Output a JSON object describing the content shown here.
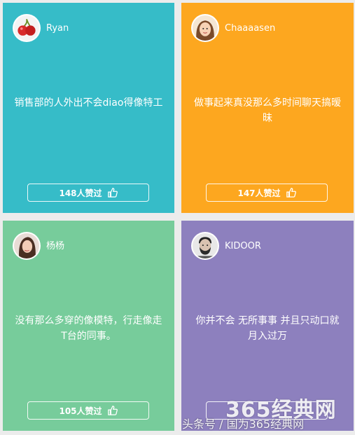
{
  "colors": {
    "teal": "#36bcc8",
    "orange": "#fda71f",
    "green": "#77cc9b",
    "purple": "#8d80be",
    "background": "#ececec"
  },
  "cards": [
    {
      "username": "Ryan",
      "avatar_icon": "cherry-avatar-icon",
      "text": "销售部的人外出不会diao得像特工",
      "likes": "148人赞过"
    },
    {
      "username": "Chaaaasen",
      "avatar_icon": "cartoon-girl-avatar-icon",
      "text": "做事起来真没那么多时间聊天搞暧昧",
      "likes": "147人赞过"
    },
    {
      "username": "杨杨",
      "avatar_icon": "woman-photo-avatar-icon",
      "text": "没有那么多穿的像模特，行走像走T台的同事。",
      "likes": "105人赞过"
    },
    {
      "username": "KIDOOR",
      "avatar_icon": "bearded-man-avatar-icon",
      "text": "你并不会 无所事事 并且只动口就月入过万",
      "likes": ""
    }
  ],
  "watermark": {
    "logo": "365经典网",
    "caption": "头条号 / 国为365经典网"
  }
}
